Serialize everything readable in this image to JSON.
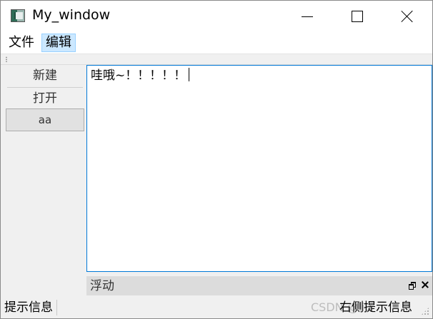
{
  "window": {
    "title": "My_window"
  },
  "menubar": {
    "items": [
      {
        "label": "文件"
      },
      {
        "label": "编辑"
      }
    ]
  },
  "side_panel": {
    "buttons": [
      {
        "label": "新建"
      },
      {
        "label": "打开"
      },
      {
        "label": "aa"
      }
    ]
  },
  "editor": {
    "text": "哇哦~！！！！！"
  },
  "dock": {
    "title": "浮动"
  },
  "statusbar": {
    "left_text": "提示信息",
    "right_text": "右侧提示信息",
    "watermark": "CSDN @liu"
  },
  "colors": {
    "accent": "#0078d7",
    "menu_highlight": "#cce8ff",
    "dock_bg": "#dcdcdc"
  }
}
